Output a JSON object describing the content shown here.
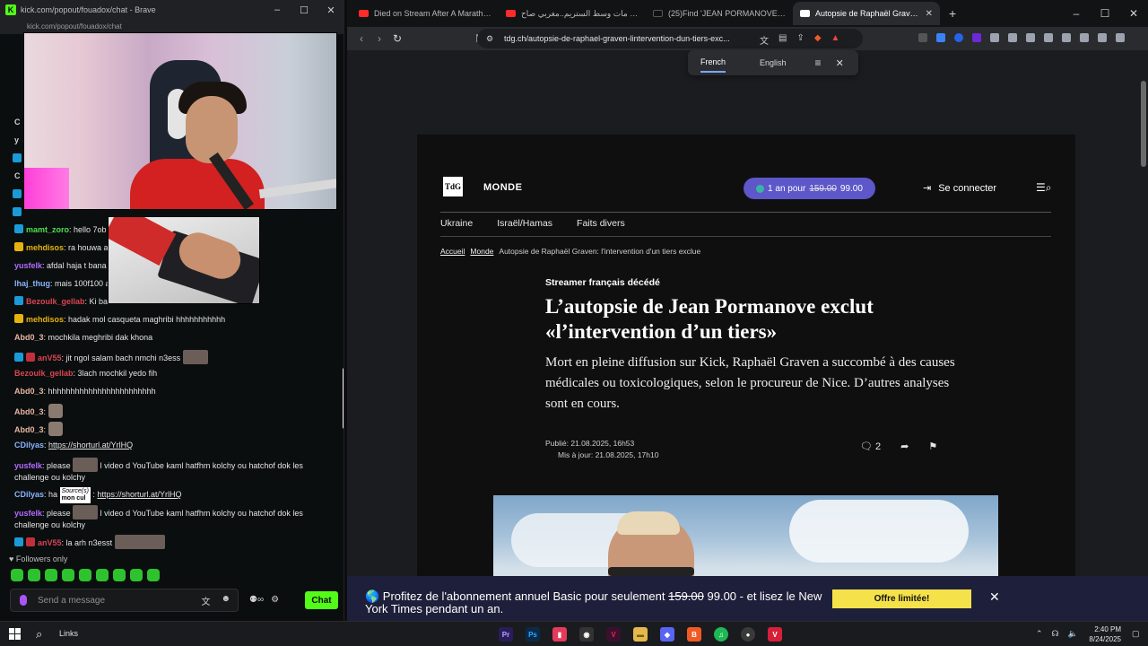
{
  "kick": {
    "window_title": "kick.com/popout/fouadox/chat - Brave",
    "url": "kick.com/popout/fouadox/chat",
    "chat": [
      {
        "badge": "blue",
        "user": "mamt_zoro",
        "color": "#4ee04e",
        "text": "hello 7ob"
      },
      {
        "badge": "gold",
        "user": "mehdisos",
        "color": "#e7b20e",
        "text": "ra houwa a"
      },
      {
        "badge": "",
        "user": "yusfelk",
        "color": "#b26cff",
        "text": "afdal haja t bana"
      },
      {
        "badge": "",
        "user": "lhaj_thug",
        "color": "#8ab4ff",
        "text": "mais 100f100 a"
      },
      {
        "badge": "blue",
        "user": "Bezoulk_gellab",
        "color": "#d94452",
        "text": "Ki ba"
      },
      {
        "badge": "gold",
        "user": "mehdisos",
        "color": "#e7b20e",
        "text": "hadak mol casqueta maghribi hhhhhhhhhhh"
      },
      {
        "badge": "",
        "user": "Abd0_3",
        "color": "#e6b6a0",
        "text": "mochkila meghribi dak khona"
      },
      {
        "badge": "blue2",
        "user": "anV55",
        "color": "#d94452",
        "text": "jit ngol salam bach nmchi n3ess"
      },
      {
        "badge": "",
        "user": "Bezoulk_gellab",
        "color": "#d94452",
        "text": "3lach mochkil yedo fih"
      },
      {
        "badge": "",
        "user": "Abd0_3",
        "color": "#e6b6a0",
        "text": "hhhhhhhhhhhhhhhhhhhhhhhh"
      },
      {
        "badge": "",
        "user": "Abd0_3",
        "color": "#e6b6a0",
        "text": ""
      },
      {
        "badge": "",
        "user": "Abd0_3",
        "color": "#e6b6a0",
        "text": ""
      },
      {
        "badge": "",
        "user": "CDilyas",
        "color": "#8ab4ff",
        "text": "",
        "link": "https://shorturl.at/YrlHQ"
      },
      {
        "badge": "",
        "user": "yusfelk",
        "color": "#b26cff",
        "text": "please",
        "text2": "l video d YouTube kaml hatfhm kolchy ou hatchof dok les challenge ou kolchy"
      },
      {
        "badge": "",
        "user": "CDilyas",
        "color": "#8ab4ff",
        "text": "ha",
        "source_label": "Source(s)",
        "source_value": "mon cul",
        "link": "https://shorturl.at/YrlHQ"
      },
      {
        "badge": "",
        "user": "yusfelk",
        "color": "#b26cff",
        "text": "please",
        "text2": "l video d YouTube kaml hatfhm kolchy ou hatchof dok les challenge ou kolchy"
      },
      {
        "badge": "blue2",
        "user": "anV55",
        "color": "#d94452",
        "text": "la arh n3esst"
      }
    ],
    "followers_only": "Followers only",
    "input_placeholder": "Send a message",
    "send_label": "Chat",
    "side_letters": [
      "C",
      "y",
      "C",
      "C",
      "C"
    ]
  },
  "browser": {
    "tabs": [
      {
        "title": "Died on Stream After A Marathon - Y",
        "favicon_color": "#ff2b2b",
        "active": false
      },
      {
        "title": "فرنسي مات وسط الستريم..مغربي صاح",
        "favicon_color": "#ff2b2b",
        "active": false
      },
      {
        "title": "(25)Find 'JEAN PORMANOVE' on Tik",
        "favicon_color": "#111111",
        "active": false
      },
      {
        "title": "Autopsie de Raphaël Graven: l'int",
        "favicon_color": "#ffffff",
        "active": true
      }
    ],
    "new_tab": "+",
    "url": "tdg.ch/autopsie-de-raphael-graven-lintervention-dun-tiers-exc...",
    "translate": {
      "lang1": "French",
      "lang2": "English"
    },
    "window_buttons": [
      "–",
      "☐",
      "✕"
    ]
  },
  "article": {
    "logo": "TdG",
    "section": "MONDE",
    "promo_prefix": "1 an pour",
    "promo_old": "159.00",
    "promo_new": "99.00",
    "login": "Se connecter",
    "subnav": [
      "Ukraine",
      "Israël/Hamas",
      "Faits divers"
    ],
    "breadcrumb": [
      "Accueil",
      "Monde",
      "Autopsie de Raphaël Graven: l'intervention d'un tiers exclue"
    ],
    "kicker": "Streamer français décédé",
    "headline": "L’autopsie de Jean Pormanove exclut «l’intervention d’un tiers»",
    "lead": "Mort en pleine diffusion sur Kick, Raphaël Graven a succombé à des causes médicales ou toxicologiques, selon le procureur de Nice. D’autres analyses sont en cours.",
    "published": "Publié: 21.08.2025, 16h53",
    "updated": "Mis à jour: 21.08.2025, 17h10",
    "comments": "2"
  },
  "banner": {
    "text_before": "🌎 Profitez de l'abonnement annuel Basic pour seulement",
    "old_price": "159.00",
    "text_after": "99.00 - et lisez le New York Times pendant un an.",
    "cta": "Offre limitée!"
  },
  "taskbar": {
    "search_label": "Links",
    "time": "2:40 PM",
    "date": "8/24/2025",
    "apps": [
      {
        "name": "premiere",
        "label": "Pr",
        "color": "#2a1c5a"
      },
      {
        "name": "photoshop",
        "label": "Ps",
        "color": "#0b2a4a"
      },
      {
        "name": "capcut",
        "label": "▮",
        "color": "#e53a5a"
      },
      {
        "name": "camera",
        "label": "◉",
        "color": "#333333"
      },
      {
        "name": "vegas",
        "label": "V",
        "color": "#3a1030"
      },
      {
        "name": "explorer",
        "label": "▬",
        "color": "#e4b84a"
      },
      {
        "name": "discord",
        "label": "◆",
        "color": "#5865f2"
      },
      {
        "name": "brave",
        "label": "B",
        "color": "#f15a24"
      },
      {
        "name": "spotify",
        "label": "♫",
        "color": "#1db954"
      },
      {
        "name": "obs",
        "label": "●",
        "color": "#3a3a3a"
      },
      {
        "name": "vivaldi",
        "label": "V",
        "color": "#d6203a"
      }
    ]
  }
}
